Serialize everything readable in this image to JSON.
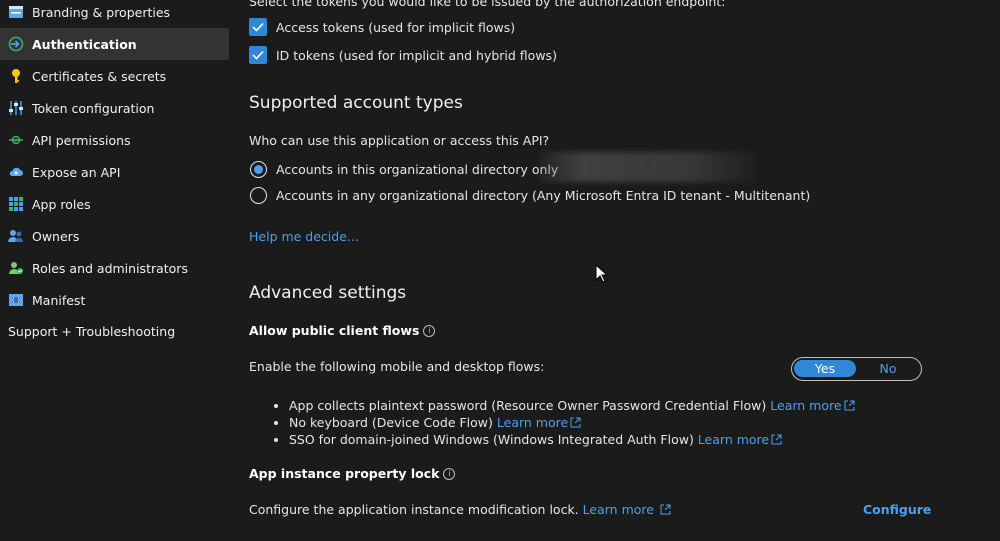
{
  "sidebar": {
    "items": [
      {
        "label": "Branding & properties",
        "icon": "branding-icon"
      },
      {
        "label": "Authentication",
        "icon": "authentication-icon",
        "active": true
      },
      {
        "label": "Certificates & secrets",
        "icon": "key-icon"
      },
      {
        "label": "Token configuration",
        "icon": "sliders-icon"
      },
      {
        "label": "API permissions",
        "icon": "api-permissions-icon"
      },
      {
        "label": "Expose an API",
        "icon": "cloud-icon"
      },
      {
        "label": "App roles",
        "icon": "app-roles-icon"
      },
      {
        "label": "Owners",
        "icon": "owners-icon"
      },
      {
        "label": "Roles and administrators",
        "icon": "roles-icon"
      },
      {
        "label": "Manifest",
        "icon": "manifest-icon"
      }
    ],
    "support_label": "Support + Troubleshooting"
  },
  "tokens": {
    "intro": "Select the tokens you would like to be issued by the authorization endpoint:",
    "access_label": "Access tokens (used for implicit flows)",
    "id_label": "ID tokens (used for implicit and hybrid flows)"
  },
  "accounts": {
    "title": "Supported account types",
    "question": "Who can use this application or access this API?",
    "option_single": "Accounts in this organizational directory only",
    "option_multi": "Accounts in any organizational directory (Any Microsoft Entra ID tenant - Multitenant)",
    "help_link": "Help me decide..."
  },
  "advanced": {
    "title": "Advanced settings",
    "public_client_title": "Allow public client flows",
    "enable_text": "Enable the following mobile and desktop flows:",
    "toggle_yes": "Yes",
    "toggle_no": "No",
    "flows": [
      {
        "text": "App collects plaintext password (Resource Owner Password Credential Flow)",
        "link": "Learn more"
      },
      {
        "text": "No keyboard (Device Code Flow)",
        "link": "Learn more"
      },
      {
        "text": "SSO for domain-joined Windows (Windows Integrated Auth Flow)",
        "link": "Learn more"
      }
    ],
    "lock_title": "App instance property lock",
    "lock_text": "Configure the application instance modification lock.",
    "lock_link": "Learn more",
    "configure_label": "Configure"
  },
  "colors": {
    "accent": "#2e87d8",
    "link": "#4aa0f0",
    "background": "#1b1b1b"
  }
}
